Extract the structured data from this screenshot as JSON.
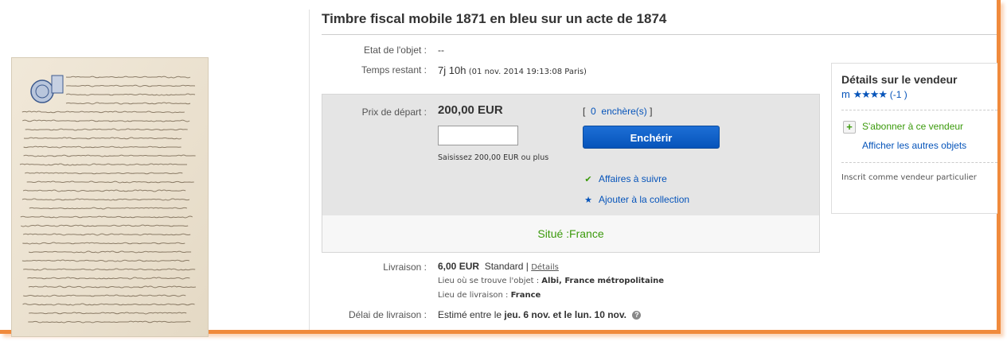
{
  "listing": {
    "title": "Timbre fiscal mobile 1871 en bleu sur un acte de 1874",
    "condition_label": "Etat de l'objet :",
    "condition_value": "--",
    "time_left_label": "Temps restant :",
    "time_left_value": "7j 10h",
    "end_time": "(01 nov. 2014  19:13:08 Paris)"
  },
  "bidding": {
    "start_price_label": "Prix de départ :",
    "start_price": "200,00 EUR",
    "bid_input_value": "",
    "hint": "Saisissez 200,00 EUR ou plus",
    "bids_open": "[",
    "bid_count": "0",
    "bids_word": "enchère(s)",
    "bids_close": "]",
    "bid_button": "Enchérir",
    "watch_link": "Affaires à suivre",
    "collection_link": "Ajouter à la collection",
    "location": "Situé :France",
    "colors": {
      "bid_button": "#0654ba",
      "location_text": "#3b9a0c",
      "frame_accent": "#f08a3c"
    }
  },
  "shipping": {
    "label": "Livraison :",
    "cost": "6,00 EUR",
    "method": "Standard",
    "sep": "|",
    "details_link": "Détails",
    "item_location_label": "Lieu où se trouve l'objet :",
    "item_location": "Albi, France métropolitaine",
    "ship_to_label": "Lieu de livraison :",
    "ship_to": "France",
    "delay_label": "Délai de livraison :",
    "delay_prefix": "Estimé entre le",
    "delay_dates": "jeu. 6 nov. et le lun. 10 nov.",
    "help_icon": "?"
  },
  "seller": {
    "heading": "Détails sur le vendeur",
    "username": "m",
    "stars": "★★★★",
    "feedback": "(-1 )",
    "subscribe_link": "S'abonner à ce vendeur",
    "subscribe_icon": "+",
    "other_items_link": "Afficher les autres objets",
    "registration": "Inscrit comme vendeur particulier"
  }
}
